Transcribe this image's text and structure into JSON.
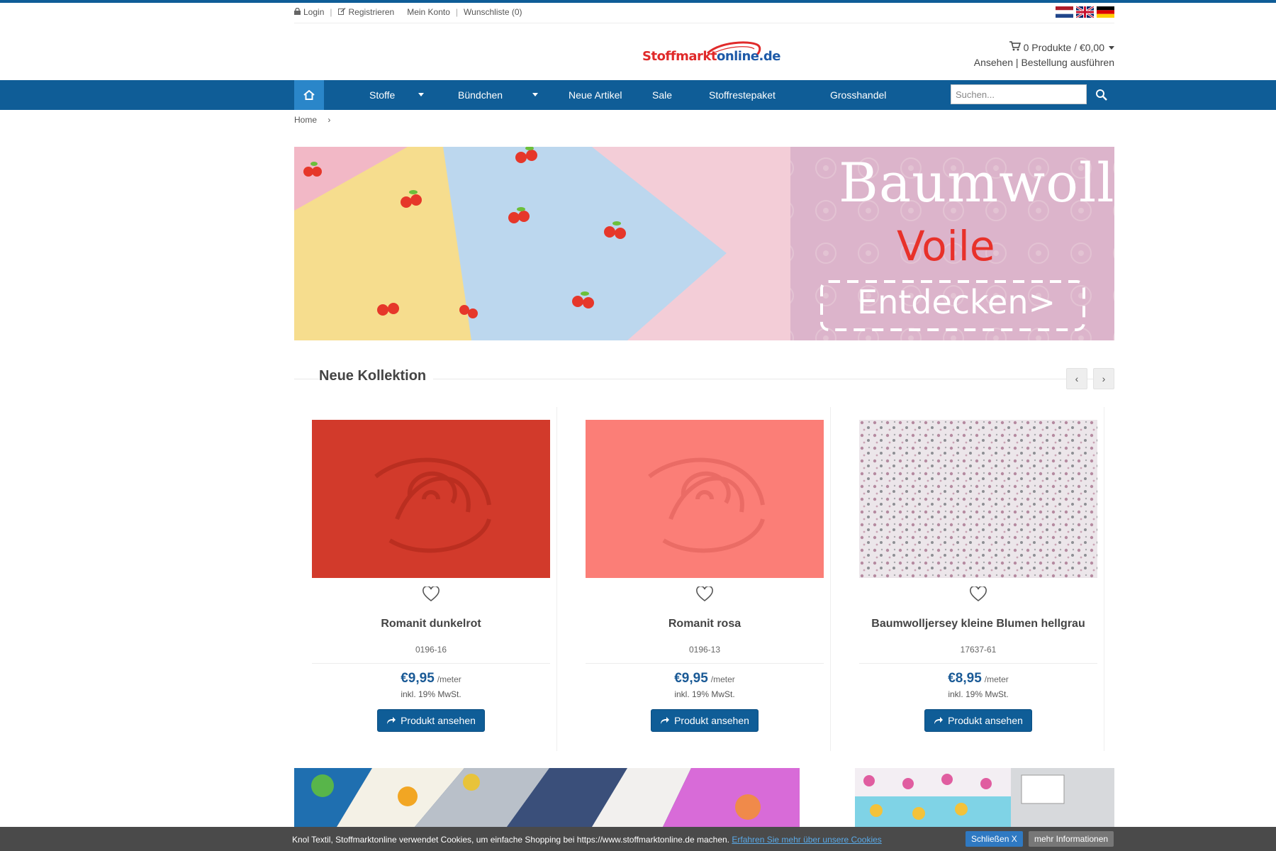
{
  "topbar": {
    "login": "Login",
    "register": "Registrieren",
    "account": "Mein Konto",
    "wishlist": "Wunschliste (0)"
  },
  "flags": [
    "nl-flag",
    "uk-flag",
    "de-flag"
  ],
  "logo": {
    "part1": "Stoffmarkt",
    "part2": "online.de"
  },
  "cart": {
    "summary": "0 Produkte / €0,00",
    "links": "Ansehen | Bestellung ausführen"
  },
  "nav": {
    "items": [
      "Stoffe",
      "Bündchen",
      "Neue Artikel",
      "Sale",
      "Stoffrestepaket",
      "Grosshandel"
    ],
    "search_placeholder": "Suchen..."
  },
  "breadcrumb": {
    "home": "Home",
    "sep": "›"
  },
  "banner": {
    "line1": "Baumwoll",
    "line2": "Voile",
    "cta": "Entdecken>"
  },
  "section": {
    "title": "Neue Kollektion",
    "prev": "‹",
    "next": "›"
  },
  "products": [
    {
      "name": "Romanit dunkelrot",
      "sku": "0196-16",
      "price": "€9,95",
      "unit": "/meter",
      "tax": "inkl. 19% MwSt.",
      "button": "Produkt ansehen",
      "color": "#d23a2b"
    },
    {
      "name": "Romanit rosa",
      "sku": "0196-13",
      "price": "€9,95",
      "unit": "/meter",
      "tax": "inkl. 19% MwSt.",
      "button": "Produkt ansehen",
      "color": "#fb7e77"
    },
    {
      "name": "Baumwolljersey kleine Blumen hellgrau",
      "sku": "17637-61",
      "price": "€8,95",
      "unit": "/meter",
      "tax": "inkl. 19% MwSt.",
      "button": "Produkt ansehen",
      "color": "#d9cfd6"
    }
  ],
  "cookie": {
    "text": "Knol Textil, Stoffmarktonline verwendet Cookies, um einfache Shopping bei https://www.stoffmarktonline.de machen.",
    "link": "Erfahren Sie mehr über unsere Cookies",
    "close": "Schließen X",
    "more": "mehr Informationen"
  },
  "colors": {
    "brand_blue": "#0f5d97",
    "price_blue": "#1a5a96",
    "home_btn": "#2a86c9"
  }
}
